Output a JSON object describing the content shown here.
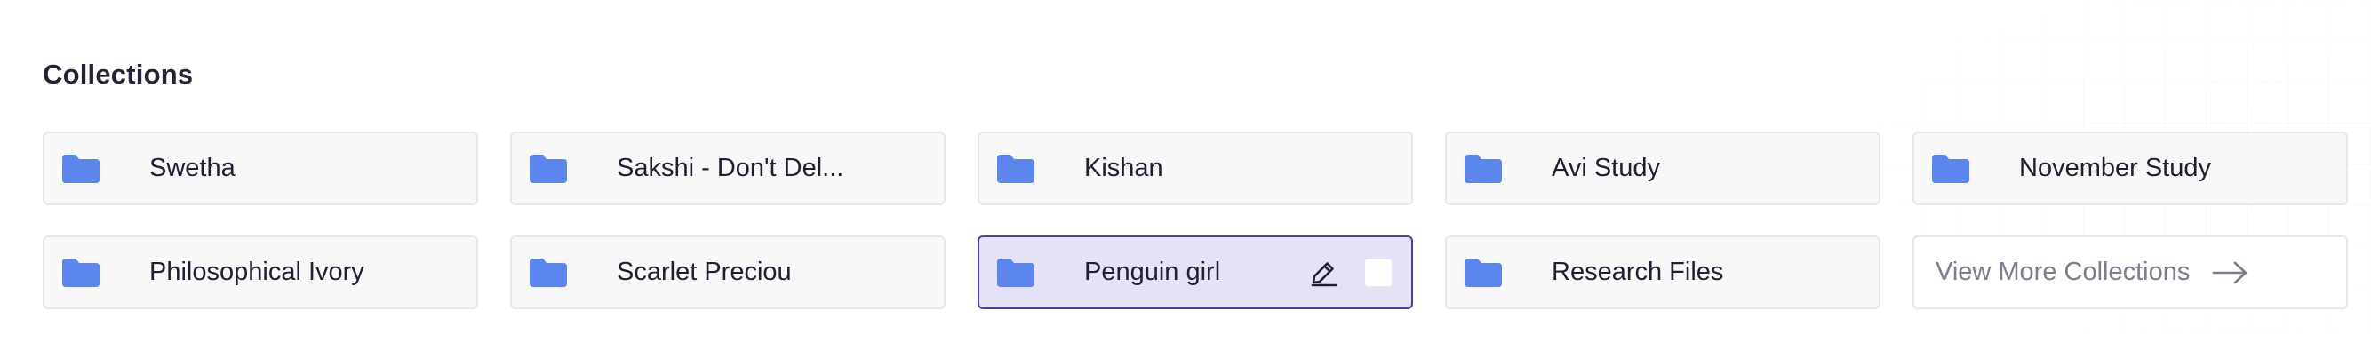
{
  "section": {
    "title": "Collections"
  },
  "collections": [
    {
      "label": "Swetha",
      "icon": "folder-icon"
    },
    {
      "label": "Sakshi - Don't Del...",
      "icon": "folder-icon"
    },
    {
      "label": "Kishan",
      "icon": "folder-icon"
    },
    {
      "label": "Avi Study",
      "icon": "folder-icon"
    },
    {
      "label": "November Study",
      "icon": "folder-icon"
    },
    {
      "label": "Philosophical Ivory",
      "icon": "folder-icon"
    },
    {
      "label": "Scarlet Preciou",
      "icon": "folder-icon"
    },
    {
      "label": "Penguin girl",
      "icon": "folder-icon",
      "selected": true,
      "actions": [
        "edit-icon",
        "checkbox"
      ]
    },
    {
      "label": "Research Files",
      "icon": "folder-icon"
    }
  ],
  "view_more": {
    "label": "View More Collections",
    "icon": "arrow-right-icon"
  },
  "colors": {
    "folder": "#5a86ee",
    "selected_bg": "#e6e2f6",
    "selected_border": "#4b3fa6",
    "card_bg": "#f8f8f8",
    "text": "#1f1f33",
    "muted_text": "#7c7c8e"
  }
}
